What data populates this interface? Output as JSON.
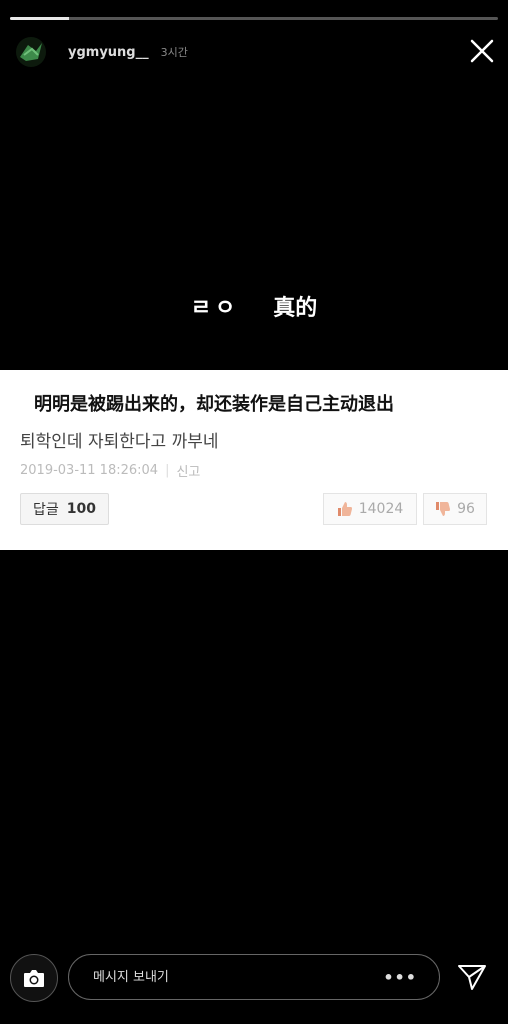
{
  "story": {
    "progress": 0.12,
    "username": "ygmyung__",
    "time": "3시간",
    "text_part1": "ㄹㅇ",
    "text_part2": "真的"
  },
  "card": {
    "overlay_text": "明明是被踢出来的，却还装作是自己主动退出",
    "comment_text": "퇴학인데 자퇴한다고 까부네",
    "timestamp": "2019-03-11 18:26:04",
    "separator": "|",
    "report_label": "신고",
    "reply_label": "답글",
    "reply_count": "100",
    "upvotes": "14024",
    "downvotes": "96"
  },
  "bottom": {
    "message_placeholder": "메시지 보내기",
    "more_label": "•••"
  },
  "icons": [
    "avatar-icon",
    "close-icon",
    "thumbs-up-icon",
    "thumbs-down-icon",
    "camera-icon",
    "send-icon"
  ],
  "colors": {
    "background": "#000000",
    "card": "#ffffff",
    "progress": "#e8e8e8"
  }
}
